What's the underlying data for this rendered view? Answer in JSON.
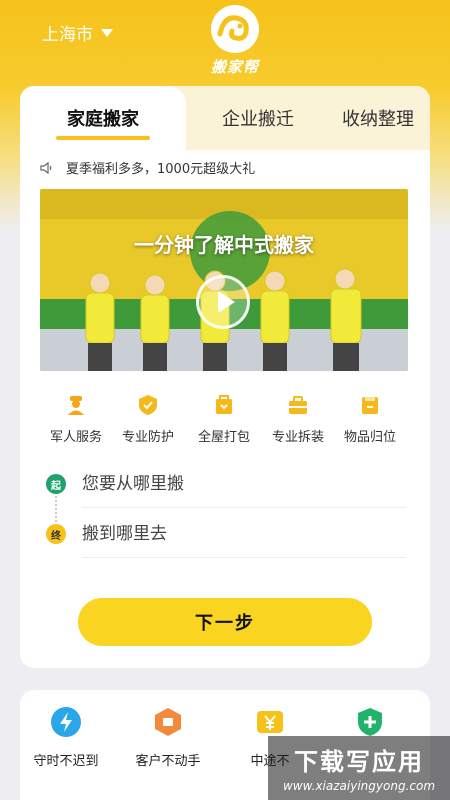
{
  "header": {
    "city": "上海市",
    "logo_text": "搬家帮"
  },
  "tabs": [
    {
      "label": "家庭搬家",
      "active": true
    },
    {
      "label": "企业搬迁",
      "active": false
    },
    {
      "label": "收纳整理",
      "active": false
    }
  ],
  "notice": {
    "text": "夏季福利多多，1000元超级大礼"
  },
  "video": {
    "title": "一分钟了解中式搬家"
  },
  "services": [
    {
      "label": "军人服务",
      "icon": "soldier-icon"
    },
    {
      "label": "专业防护",
      "icon": "shield-icon"
    },
    {
      "label": "全屋打包",
      "icon": "package-icon"
    },
    {
      "label": "专业拆装",
      "icon": "toolbox-icon"
    },
    {
      "label": "物品归位",
      "icon": "box-icon"
    }
  ],
  "address": {
    "start_badge": "起",
    "start_placeholder": "您要从哪里搬",
    "end_badge": "终",
    "end_placeholder": "搬到哪里去"
  },
  "next_button": "下一步",
  "features": [
    {
      "label": "守时不迟到",
      "icon": "lightning-icon",
      "color": "#2aa7e8"
    },
    {
      "label": "客户不动手",
      "icon": "hexagon-icon",
      "color": "#f08a3c"
    },
    {
      "label": "中途不",
      "icon": "yuan-icon",
      "color": "#f6c21a"
    },
    {
      "label": "",
      "icon": "shield-plus-icon",
      "color": "#20b46a"
    }
  ],
  "watermark": {
    "title": "下载写应用",
    "url": "www.xiazaiyingyong.com"
  },
  "colors": {
    "brand_yellow": "#f6c21a",
    "button_yellow": "#f9d420",
    "start_green": "#1fa36b"
  }
}
